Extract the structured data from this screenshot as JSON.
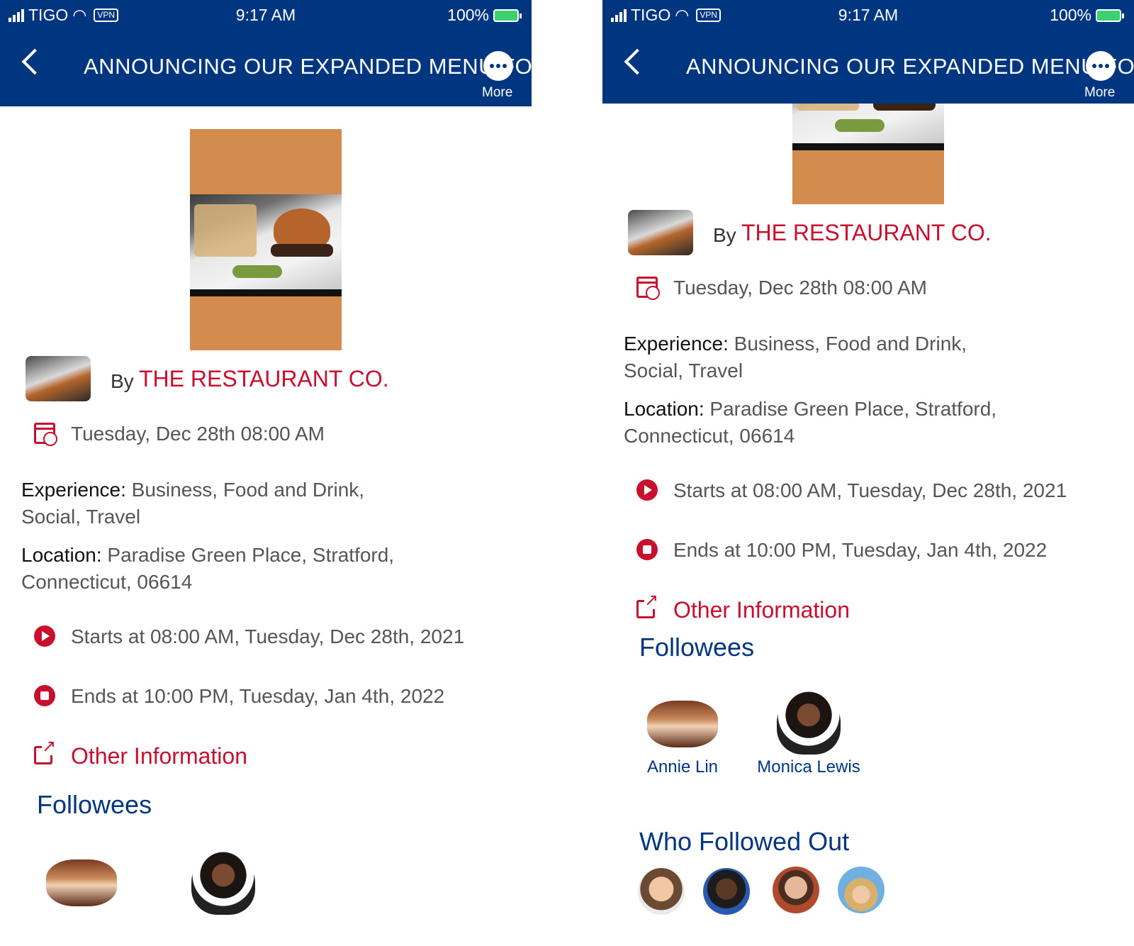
{
  "status_bar": {
    "carrier": "TIGO",
    "vpn": "VPN",
    "time": "9:17 AM",
    "battery": "100%"
  },
  "nav": {
    "title": "ANNOUNCING OUR EXPANDED MENU FO",
    "more_label": "More"
  },
  "event": {
    "by_label": "By",
    "author": "THE RESTAURANT CO.",
    "date": "Tuesday, Dec 28th 08:00 AM",
    "experience_label": "Experience:",
    "experience_line1": "Business, Food and Drink,",
    "experience_line2": "Social, Travel",
    "location_label": "Location:",
    "location_line1": "Paradise Green Place, Stratford,",
    "location_line2": "Connecticut, 06614",
    "starts": "Starts at 08:00 AM, Tuesday, Dec 28th, 2021",
    "ends": "Ends at 10:00 PM, Tuesday, Jan 4th, 2022",
    "other_info": "Other Information"
  },
  "followees": {
    "title": "Followees",
    "people": [
      {
        "name": "Annie Lin"
      },
      {
        "name": "Monica Lewis"
      }
    ]
  },
  "who_followed_out": {
    "title": "Who Followed Out"
  },
  "colors": {
    "nav": "#003580",
    "accent": "#c8102e",
    "heading": "#003580",
    "hero_bg": "#d48b4e"
  },
  "icons": [
    "back-chevron-icon",
    "more-dots-icon",
    "calendar-clock-icon",
    "play-circle-icon",
    "stop-circle-icon",
    "external-link-icon"
  ]
}
